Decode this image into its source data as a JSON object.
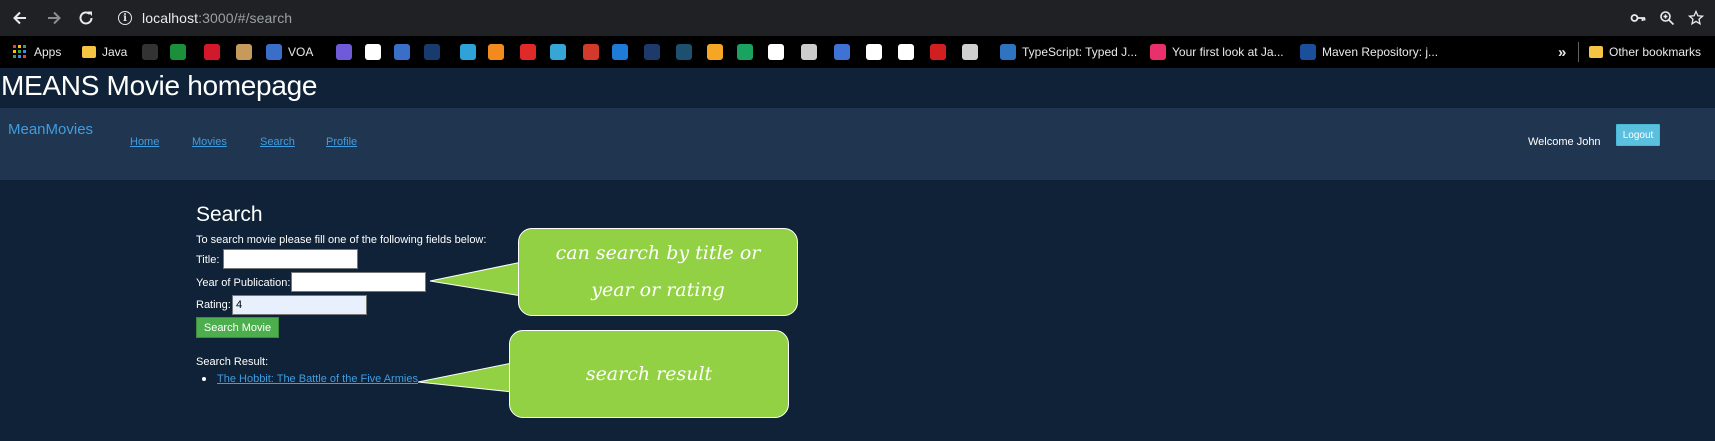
{
  "browser": {
    "url_host": "localhost",
    "url_path": ":3000/#/search",
    "bookmarks": [
      {
        "label": "Apps",
        "icon": "apps-grid-icon",
        "color": "#ea4335"
      },
      {
        "label": "Java",
        "icon": "folder-icon",
        "color": "#f4c542"
      },
      {
        "label": "",
        "icon": "github-icon",
        "color": "#333333"
      },
      {
        "label": "",
        "icon": "w-icon",
        "color": "#1b8f3a"
      },
      {
        "label": "",
        "icon": "o-icon",
        "color": "#d3182c"
      },
      {
        "label": "",
        "icon": "package-icon",
        "color": "#c59a5a"
      },
      {
        "label": "VOA",
        "icon": "voa-icon",
        "color": "#3a6fc9"
      },
      {
        "label": "",
        "icon": "code-icon",
        "color": "#6f5bd9"
      },
      {
        "label": "",
        "icon": "bird-icon",
        "color": "#ffffff"
      },
      {
        "label": "",
        "icon": "voa-icon",
        "color": "#3a6fc9"
      },
      {
        "label": "",
        "icon": "x-icon",
        "color": "#173b6c"
      },
      {
        "label": "",
        "icon": "flag-icon",
        "color": "#2ea3d8"
      },
      {
        "label": "",
        "icon": "box-icon",
        "color": "#f28a1d"
      },
      {
        "label": "",
        "icon": "oracle-icon",
        "color": "#e02a2a"
      },
      {
        "label": "",
        "icon": "ev-icon",
        "color": "#35a6d6"
      },
      {
        "label": "",
        "icon": "circle-icon",
        "color": "#d33a2c"
      },
      {
        "label": "",
        "icon": "azure-icon",
        "color": "#1f7bd8"
      },
      {
        "label": "",
        "icon": "tr-icon",
        "color": "#1e3a6b"
      },
      {
        "label": "",
        "icon": "tds-icon",
        "color": "#1d4f6e"
      },
      {
        "label": "",
        "icon": "person-icon",
        "color": "#f5a623"
      },
      {
        "label": "",
        "icon": "glasses-icon",
        "color": "#1aa260"
      },
      {
        "label": "",
        "icon": "cube-icon",
        "color": "#ffffff"
      },
      {
        "label": "",
        "icon": "pattern-icon",
        "color": "#cccccc"
      },
      {
        "label": "",
        "icon": "r-icon",
        "color": "#3f72d4"
      },
      {
        "label": "",
        "icon": "shield-icon",
        "color": "#ffffff"
      },
      {
        "label": "",
        "icon": "cube-icon",
        "color": "#ffffff"
      },
      {
        "label": "",
        "icon": "figure-icon",
        "color": "#d11f1f"
      },
      {
        "label": "",
        "icon": "card-icon",
        "color": "#d0d0d0"
      },
      {
        "label": "TypeScript: Typed J...",
        "icon": "ts-icon",
        "color": "#2f74c0"
      },
      {
        "label": "Your first look at Ja...",
        "icon": "jetbrains-icon",
        "color": "#e9306c"
      },
      {
        "label": "Maven Repository: j...",
        "icon": "maven-icon",
        "color": "#1a4f9c"
      }
    ],
    "overflow_label": "»",
    "other_bookmarks": "Other bookmarks"
  },
  "page": {
    "title": "MEANS Movie homepage"
  },
  "navbar": {
    "brand": "MeanMovies",
    "links": [
      "Home",
      "Movies",
      "Search",
      "Profile"
    ],
    "welcome": "Welcome John",
    "logout": "Logout"
  },
  "search": {
    "heading": "Search",
    "instructions": "To search movie please fill one of the following fields below:",
    "title_label": "Title:",
    "title_value": "",
    "year_label": "Year of Publication:",
    "year_value": "",
    "rating_label": "Rating:",
    "rating_value": "4",
    "button": "Search Movie",
    "result_label": "Search Result:",
    "results": [
      "The Hobbit: The Battle of the Five Armies"
    ]
  },
  "callouts": {
    "search_fields": "can search by title or year or rating",
    "search_result": "search result",
    "color": "#92d144"
  }
}
